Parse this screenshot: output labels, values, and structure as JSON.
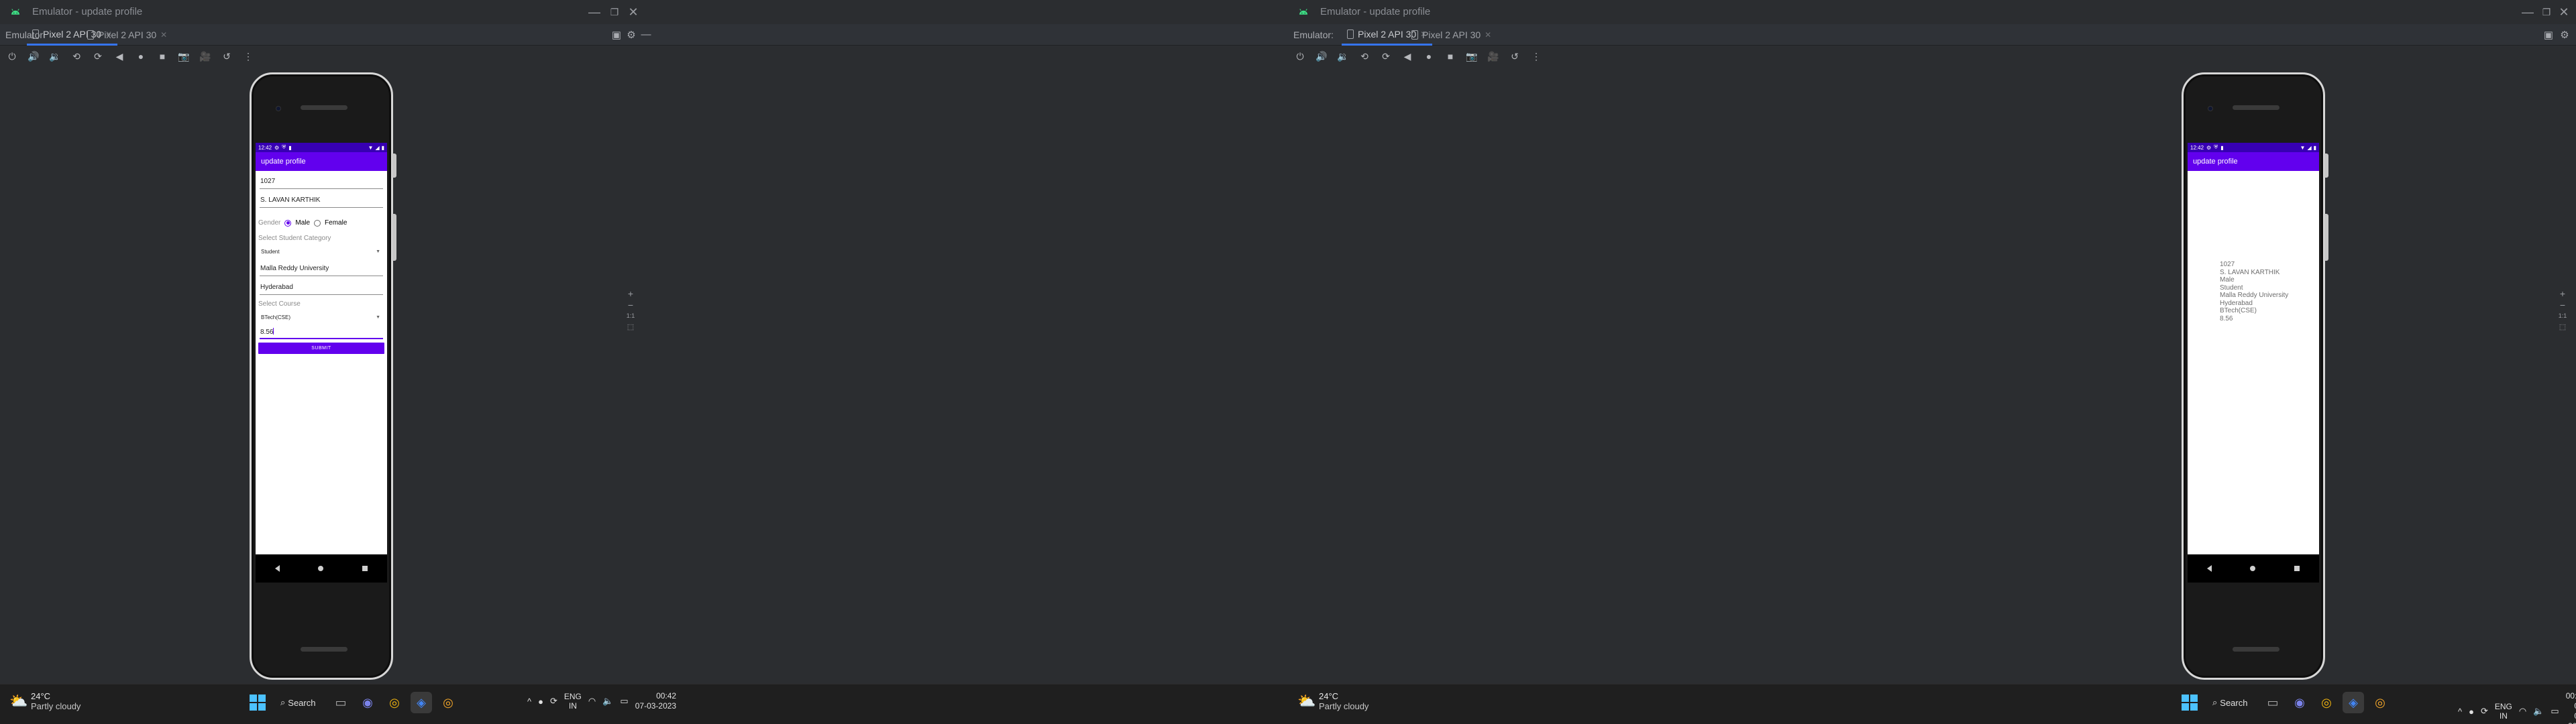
{
  "window": {
    "title": "Emulator - update profile",
    "emulator_label": "Emulator:",
    "tabs": [
      {
        "label": "Pixel 2 API 30",
        "active": true
      },
      {
        "label": "Pixel 2 API 30",
        "active": false
      }
    ]
  },
  "device": {
    "time": "12:42",
    "app_title": "update profile"
  },
  "form": {
    "id_value": "1027",
    "name_value": "S. LAVAN KARTHIK",
    "gender_label": "Gender",
    "gender_options": [
      "Male",
      "Female"
    ],
    "gender_selected": "Male",
    "category_label": "Select Student Category",
    "category_selected": "Student",
    "university_value": "Malla Reddy University",
    "city_value": "Hyderabad",
    "course_label": "Select Course",
    "course_selected": "BTech(CSE)",
    "gpa_value": "8.56",
    "submit_label": "SUBMIT"
  },
  "result": {
    "lines": [
      "1027",
      "S. LAVAN KARTHIK",
      "Male",
      "Student",
      "Malla Reddy University",
      "Hyderabad",
      "BTech(CSE)",
      "8.56"
    ]
  },
  "zoom": {
    "plus": "+",
    "minus": "−",
    "ratio": "1:1"
  },
  "taskbar": {
    "weather_temp": "24°C",
    "weather_condition": "Partly cloudy",
    "search_label": "Search",
    "language_line1": "ENG",
    "language_line2": "IN",
    "clock_time": "00:42",
    "clock_date": "07-03-2023"
  },
  "colors": {
    "app_bar": "#6200ee",
    "status_bar": "#3700b3",
    "ide_background": "#2b2d30",
    "taskbar": "#1f1f1f"
  }
}
